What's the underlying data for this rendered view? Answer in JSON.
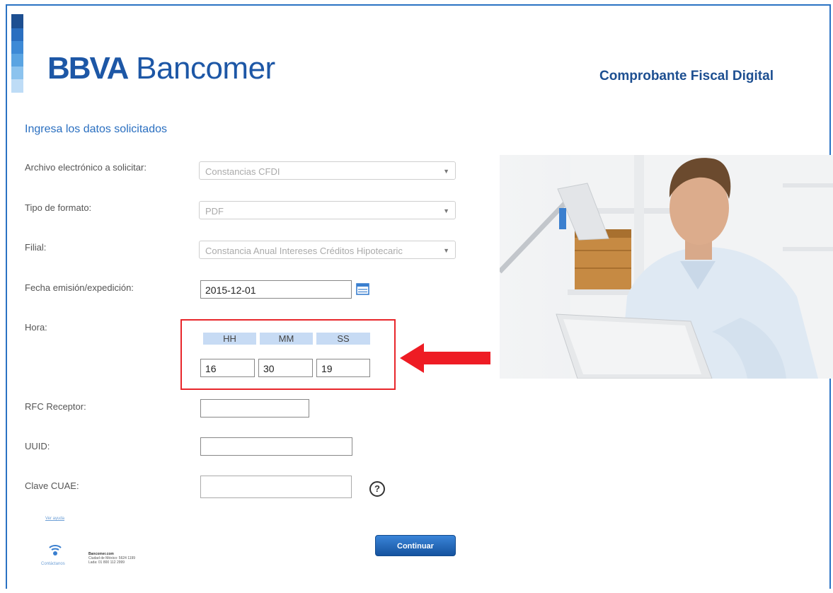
{
  "header": {
    "logo_bold": "BBVA",
    "logo_light": "Bancomer",
    "doc_title": "Comprobante Fiscal Digital"
  },
  "form": {
    "section_title": "Ingresa los datos solicitados",
    "archivo_label": "Archivo electrónico a solicitar:",
    "archivo_value": "Constancias CFDI",
    "formato_label": "Tipo de formato:",
    "formato_value": "PDF",
    "filial_label": "Filial:",
    "filial_value": "Constancia Anual Intereses Créditos Hipotecaric",
    "fecha_label": "Fecha emisión/expedición:",
    "fecha_value": "2015-12-01",
    "hora_label": "Hora:",
    "hh_label": "HH",
    "mm_label": "MM",
    "ss_label": "SS",
    "hh_value": "16",
    "mm_value": "30",
    "ss_value": "19",
    "rfc_label": "RFC Receptor:",
    "rfc_value": "",
    "uuid_label": "UUID:",
    "uuid_value": "",
    "cuae_label": "Clave CUAE:",
    "cuae_value": "",
    "help_glyph": "?",
    "continue_label": "Continuar"
  },
  "footer": {
    "link": "Ver ayuda",
    "contact_label": "Contáctanos",
    "site": "Bancomer.com",
    "line1": "Ciudad de México: 5624 1199",
    "line2": "Lada: 01 800 112 2999"
  },
  "colors": {
    "brand_blue": "#1d57a6",
    "frame_blue": "#2a72c3",
    "highlight_red": "#e8262b",
    "time_header": "#c7dbf4"
  },
  "icons": {
    "calendar": "calendar-icon",
    "help": "help-icon",
    "arrow": "arrow-left-icon",
    "contact": "contact-icon"
  }
}
